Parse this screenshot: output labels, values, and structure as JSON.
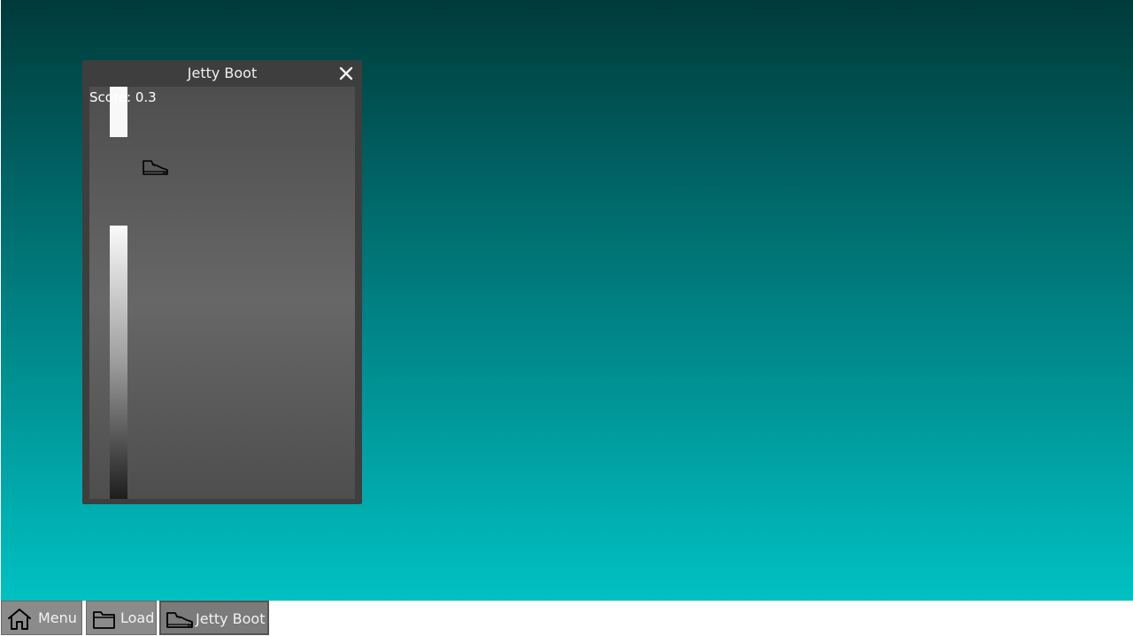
{
  "window": {
    "title": "Jetty Boot",
    "close_icon": "close-icon"
  },
  "game": {
    "score_text": "Score: 0.3",
    "player_icon": "shoe-icon"
  },
  "taskbar": {
    "items": [
      {
        "label": "Menu",
        "icon": "home-icon",
        "active": false
      },
      {
        "label": "Load",
        "icon": "folder-icon",
        "active": false
      },
      {
        "label": "Jetty Boot",
        "icon": "shoe-icon",
        "active": true
      }
    ]
  },
  "colors": {
    "desktop_top": "#003a3a",
    "desktop_bottom": "#00c1c3",
    "window_frame": "#3e3e3e",
    "taskbar_button": "#8b8b8b"
  }
}
